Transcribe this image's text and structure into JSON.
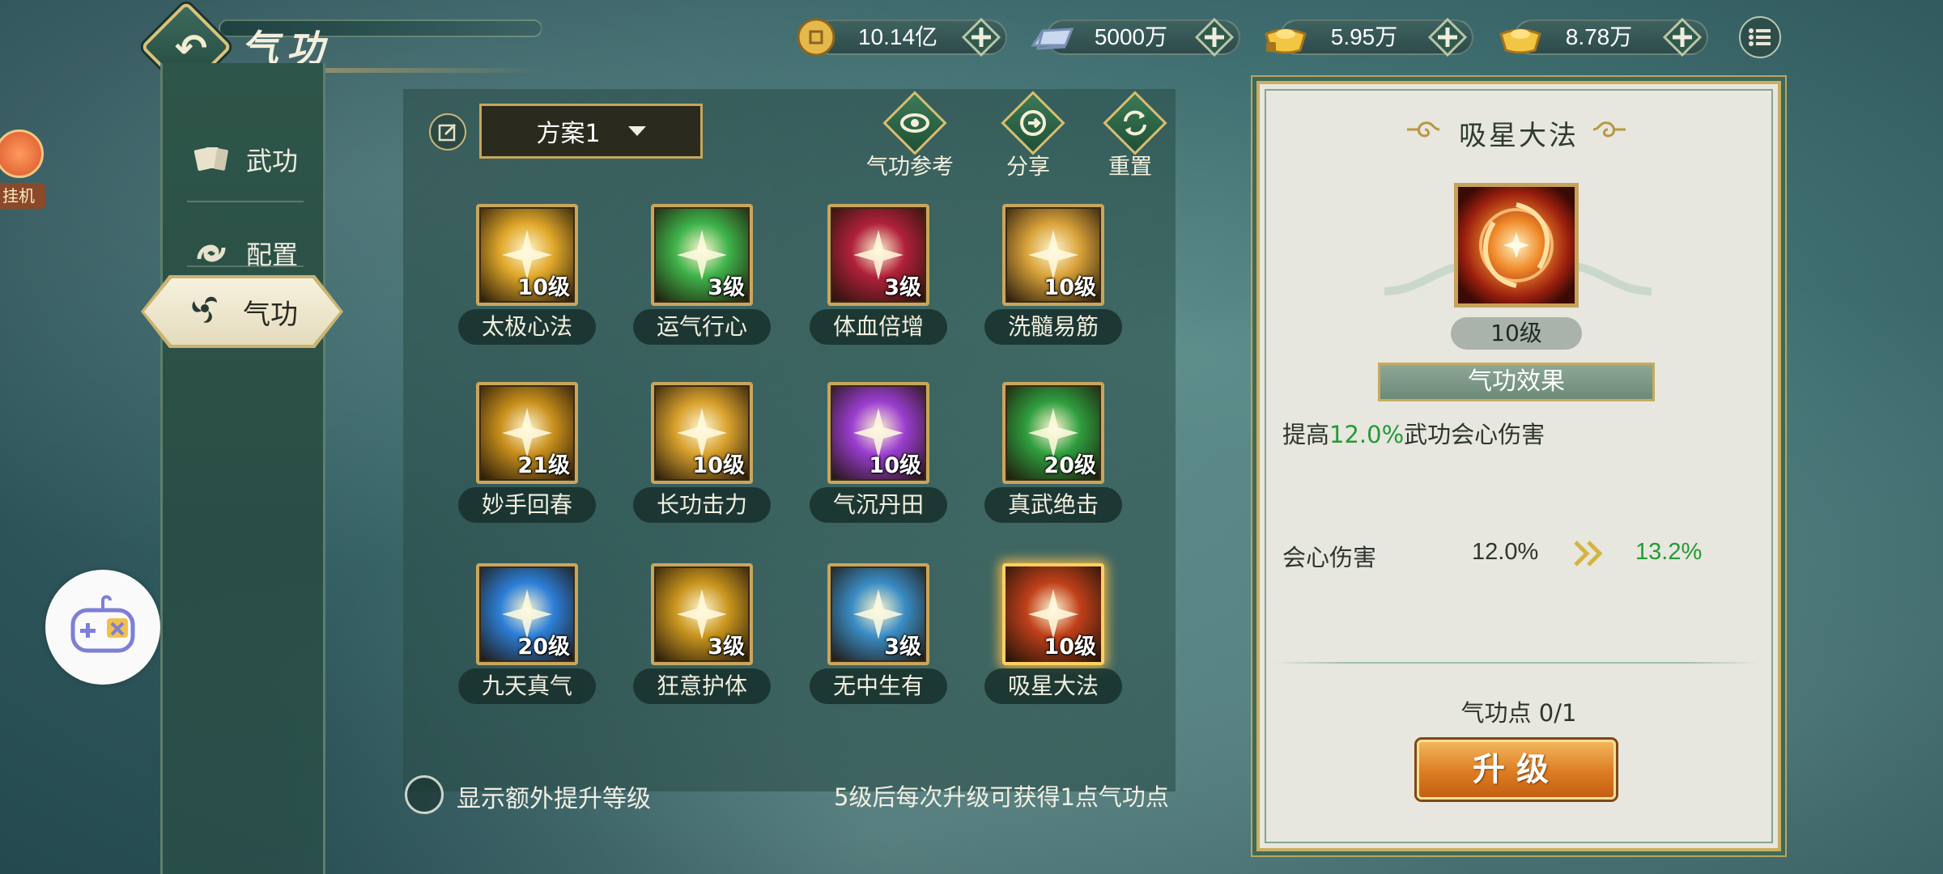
{
  "header": {
    "title": "气功"
  },
  "nav": {
    "items": [
      {
        "label": "武功",
        "icon": "cards-icon"
      },
      {
        "label": "配置",
        "icon": "swirl-icon"
      },
      {
        "label": "气功",
        "icon": "triskelion-icon",
        "active": true
      }
    ]
  },
  "side_widgets": {
    "auto_hang_label": "挂机"
  },
  "currencies": [
    {
      "icon": "copper-coin-icon",
      "value": "10.14亿"
    },
    {
      "icon": "silver-ingot-icon",
      "value": "5000万"
    },
    {
      "icon": "locked-gold-ingot-icon",
      "value": "5.95万"
    },
    {
      "icon": "gold-ingot-icon",
      "value": "8.78万"
    }
  ],
  "toolbar": {
    "scheme_label": "方案1",
    "actions": [
      {
        "label": "气功参考",
        "icon": "eye-icon"
      },
      {
        "label": "分享",
        "icon": "share-icon"
      },
      {
        "label": "重置",
        "icon": "reset-icon"
      }
    ]
  },
  "skills": [
    {
      "name": "太极心法",
      "level": "10级",
      "color": "#e0a82a"
    },
    {
      "name": "运气行心",
      "level": "3级",
      "color": "#3fb34a"
    },
    {
      "name": "体血倍增",
      "level": "3级",
      "color": "#b0213a"
    },
    {
      "name": "洗髓易筋",
      "level": "10级",
      "color": "#d9a23a"
    },
    {
      "name": "妙手回春",
      "level": "21级",
      "color": "#c88f1c"
    },
    {
      "name": "长功击力",
      "level": "10级",
      "color": "#d7a02c"
    },
    {
      "name": "气沉丹田",
      "level": "10级",
      "color": "#9a3ed0"
    },
    {
      "name": "真武绝击",
      "level": "20级",
      "color": "#2f9e3f"
    },
    {
      "name": "九天真气",
      "level": "20级",
      "color": "#2d7fd8"
    },
    {
      "name": "狂意护体",
      "level": "3级",
      "color": "#c9951e"
    },
    {
      "name": "无中生有",
      "level": "3级",
      "color": "#3a8cc4"
    },
    {
      "name": "吸星大法",
      "level": "10级",
      "color": "#c0401a",
      "selected": true
    }
  ],
  "footer": {
    "extra_level_label": "显示额外提升等级",
    "hint": "5级后每次升级可获得1点气功点"
  },
  "detail": {
    "title": "吸星大法",
    "level": "10级",
    "effect_banner": "气功效果",
    "effect_prefix": "提高",
    "effect_value": "12.0%",
    "effect_suffix": "武功会心伤害",
    "stat_name": "会心伤害",
    "stat_current": "12.0%",
    "stat_next": "13.2%",
    "points": "气功点 0/1",
    "upgrade_label": "升级"
  },
  "colors": {
    "accent_gold": "#c9ad62",
    "highlight_green": "#239a35",
    "upgrade_orange": "#dd7c22"
  }
}
